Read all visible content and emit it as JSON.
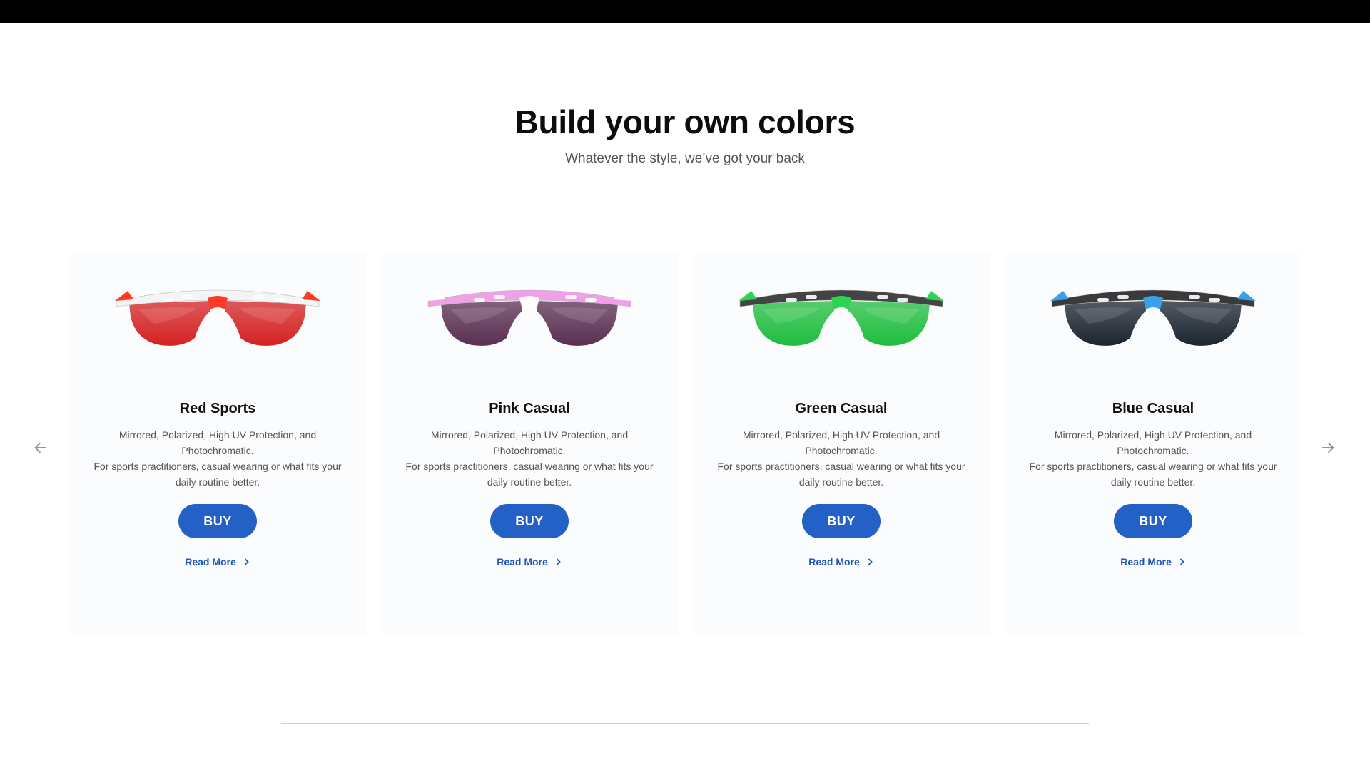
{
  "header": {
    "title": "Build your own colors",
    "subtitle": "Whatever the style, we’ve got your back"
  },
  "carousel": {
    "prev_icon": "arrow-left-icon",
    "next_icon": "arrow-right-icon",
    "cards": [
      {
        "name": "Red Sports",
        "desc_line1": "Mirrored, Polarized, High UV Protection, and Photochromatic.",
        "desc_line2": "For sports practitioners, casual wearing or what fits your daily routine better.",
        "buy_label": "BUY",
        "read_more": "Read More",
        "frame_color": "#f4f4f4",
        "accent_color": "#ff3b24",
        "lens_color": "#d42222"
      },
      {
        "name": "Pink Casual",
        "desc_line1": "Mirrored, Polarized, High UV Protection, and Photochromatic.",
        "desc_line2": "For sports practitioners, casual wearing or what fits your daily routine better.",
        "buy_label": "BUY",
        "read_more": "Read More",
        "frame_color": "#f0a0e6",
        "accent_color": "#ffffff",
        "lens_color": "#5a2f52"
      },
      {
        "name": "Green Casual",
        "desc_line1": "Mirrored, Polarized, High UV Protection, and Photochromatic.",
        "desc_line2": "For sports practitioners, casual wearing or what fits your daily routine better.",
        "buy_label": "BUY",
        "read_more": "Read More",
        "frame_color": "#444444",
        "accent_color": "#2dd452",
        "lens_color": "#1fbd3e"
      },
      {
        "name": "Blue Casual",
        "desc_line1": "Mirrored, Polarized, High UV Protection, and Photochromatic.",
        "desc_line2": "For sports practitioners, casual wearing or what fits your daily routine better.",
        "buy_label": "BUY",
        "read_more": "Read More",
        "frame_color": "#3a3a3a",
        "accent_color": "#3aa0ea",
        "lens_color": "#1b2430"
      }
    ]
  },
  "colors": {
    "button": "#2461c6",
    "link": "#1f57b5",
    "card_bg": "#fbfcfe"
  }
}
